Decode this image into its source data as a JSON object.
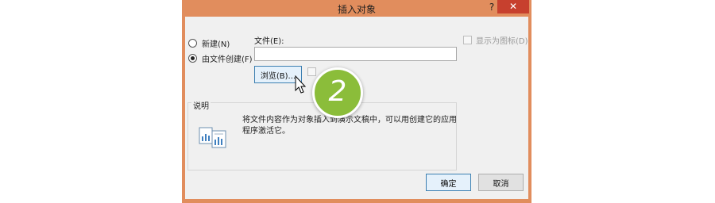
{
  "dialog": {
    "title": "插入对象",
    "help_label": "?",
    "close_label": "✕"
  },
  "options": {
    "new_label": "新建(N)",
    "from_file_label": "由文件创建(F)",
    "selected": "from_file"
  },
  "file": {
    "label": "文件(E):",
    "value": "",
    "browse_label": "浏览(B)..."
  },
  "display_as_icon": {
    "label": "显示为图标(D)",
    "checked": false
  },
  "description": {
    "group_label": "说明",
    "text": "将文件内容作为对象插入到演示文稿中，可以用创建它的应用程序激活它。"
  },
  "buttons": {
    "ok_label": "确定",
    "cancel_label": "取消"
  },
  "overlay": {
    "step_number": "2"
  },
  "colors": {
    "frame": "#e18d5d",
    "close_button": "#c7402e",
    "badge": "#8bbd3a"
  }
}
